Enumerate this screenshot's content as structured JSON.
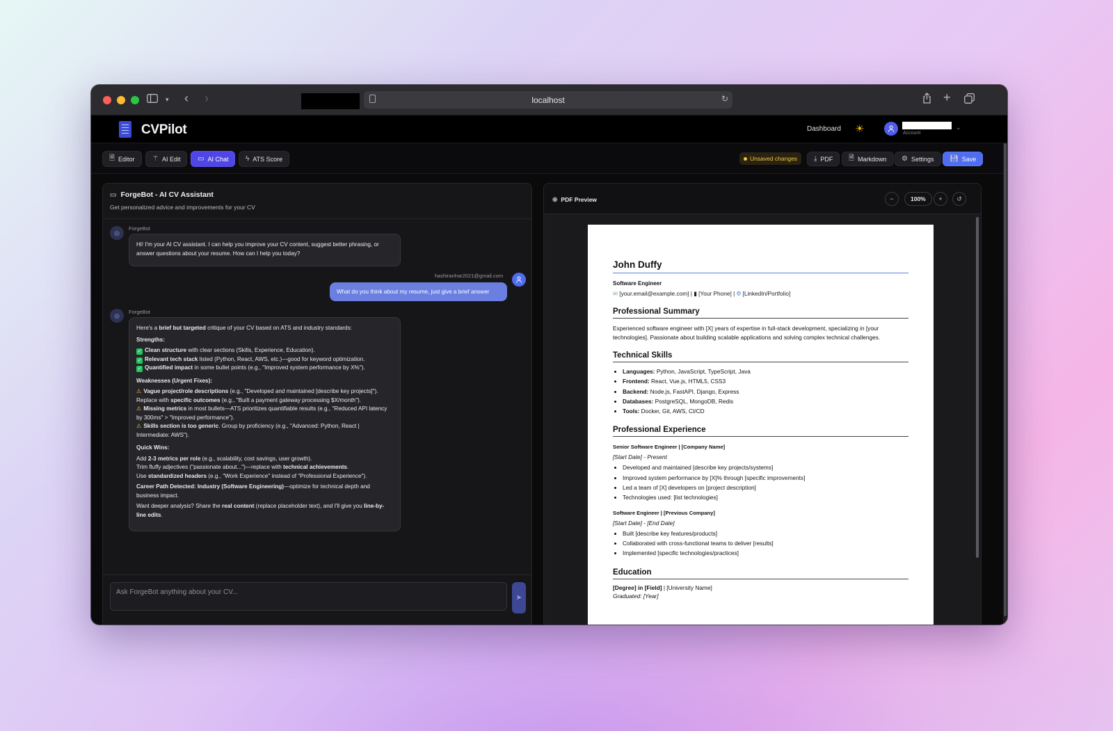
{
  "browser": {
    "url": "localhost"
  },
  "header": {
    "brand": "CVPilot",
    "nav_dashboard": "Dashboard",
    "account_label": "Account"
  },
  "toolbar": {
    "tabs": [
      {
        "label": "Editor",
        "icon": "document-icon"
      },
      {
        "label": "AI Edit",
        "icon": "wand-icon"
      },
      {
        "label": "AI Chat",
        "icon": "chat-icon"
      },
      {
        "label": "ATS Score",
        "icon": "bolt-icon"
      }
    ],
    "active_tab": "AI Chat",
    "unsaved": "Unsaved changes",
    "pdf": "PDF",
    "markdown": "Markdown",
    "settings": "Settings",
    "save": "Save"
  },
  "chat": {
    "title": "ForgeBot - AI CV Assistant",
    "subtitle": "Get personalized advice and improvements for your CV",
    "bot_name": "ForgeBot",
    "greeting": "Hi! I'm your AI CV assistant. I can help you improve your CV content, suggest better phrasing, or answer questions about your resume. How can I help you today?",
    "user_email": "hashiranhar2021@gmail.com",
    "user_message": "What do you think about my resume, just give a brief answer",
    "reply": {
      "intro_pre": "Here's a ",
      "intro_bold": "brief but targeted",
      "intro_post": " critique of your CV based on ATS and industry standards:",
      "strengths_title": "Strengths:",
      "strengths": [
        {
          "bold": "Clean structure",
          "text": " with clear sections (Skills, Experience, Education)."
        },
        {
          "bold": "Relevant tech stack",
          "text": " listed (Python, React, AWS, etc.)—good for keyword optimization."
        },
        {
          "bold": "Quantified impact",
          "text": " in some bullet points (e.g., \"Improved system performance by X%\")."
        }
      ],
      "weaknesses_title": "Weaknesses (Urgent Fixes):",
      "weaknesses": [
        {
          "bold": "Vague project/role descriptions",
          "text": " (e.g., \"Developed and maintained [describe key projects]\"). Replace with ",
          "bold2": "specific outcomes",
          "text2": " (e.g., \"Built a payment gateway processing $X/month\")."
        },
        {
          "bold": "Missing metrics",
          "text": " in most bullets—ATS prioritizes quantifiable results (e.g., \"Reduced API latency by 300ms\" > \"Improved performance\").",
          "bold2": "",
          "text2": ""
        },
        {
          "bold": "Skills section is too generic",
          "text": ". Group by proficiency (e.g., \"Advanced: Python, React | Intermediate: AWS\").",
          "bold2": "",
          "text2": ""
        }
      ],
      "quickwins_title": "Quick Wins:",
      "qw1_pre": "Add ",
      "qw1_bold": "2-3 metrics per role",
      "qw1_post": " (e.g., scalability, cost savings, user growth).",
      "qw2_pre": "Trim fluffy adjectives (\"passionate about...\")—replace with ",
      "qw2_bold": "technical achievements",
      "qw2_post": ".",
      "qw3_pre": "Use ",
      "qw3_bold": "standardized headers",
      "qw3_post": " (e.g., \"Work Experience\" instead of \"Professional Experience\").",
      "career_bold": "Career Path Detected: Industry (Software Engineering)",
      "career_post": "—optimize for technical depth and business impact.",
      "closing_pre": "Want deeper analysis? Share the ",
      "closing_bold": "real content",
      "closing_mid": " (replace placeholder text), and I'll give you ",
      "closing_bold2": "line-by-line edits",
      "closing_post": "."
    },
    "input_placeholder": "Ask ForgeBot anything about your CV..."
  },
  "preview": {
    "title": "PDF Preview",
    "zoom": "100%"
  },
  "cv": {
    "name": "John Duffy",
    "role": "Software Engineer",
    "contact_email": "[your.email@example.com] |",
    "contact_phone": "[Your Phone] |",
    "contact_link": "[LinkedIn/Portfolio]",
    "summary_title": "Professional Summary",
    "summary": "Experienced software engineer with [X] years of expertise in full-stack development, specializing in [your technologies]. Passionate about building scalable applications and solving complex technical challenges.",
    "skills_title": "Technical Skills",
    "skills": [
      {
        "label": "Languages:",
        "value": " Python, JavaScript, TypeScript, Java"
      },
      {
        "label": "Frontend:",
        "value": " React, Vue.js, HTML5, CSS3"
      },
      {
        "label": "Backend:",
        "value": " Node.js, FastAPI, Django, Express"
      },
      {
        "label": "Databases:",
        "value": " PostgreSQL, MongoDB, Redis"
      },
      {
        "label": "Tools:",
        "value": " Docker, Git, AWS, CI/CD"
      }
    ],
    "experience_title": "Professional Experience",
    "jobs": [
      {
        "title": "Senior Software Engineer | [Company Name]",
        "date": "[Start Date] - Present",
        "bullets": [
          "Developed and maintained [describe key projects/systems]",
          "Improved system performance by [X]% through [specific improvements]",
          "Led a team of [X] developers on [project description]",
          "Technologies used: [list technologies]"
        ]
      },
      {
        "title": "Software Engineer | [Previous Company]",
        "date": "[Start Date] - [End Date]",
        "bullets": [
          "Built [describe key features/products]",
          "Collaborated with cross-functional teams to deliver [results]",
          "Implemented [specific technologies/practices]"
        ]
      }
    ],
    "education_title": "Education",
    "degree_bold": "[Degree] in [Field]",
    "degree_rest": " | [University Name]",
    "graduated": "Graduated: [Year]"
  }
}
